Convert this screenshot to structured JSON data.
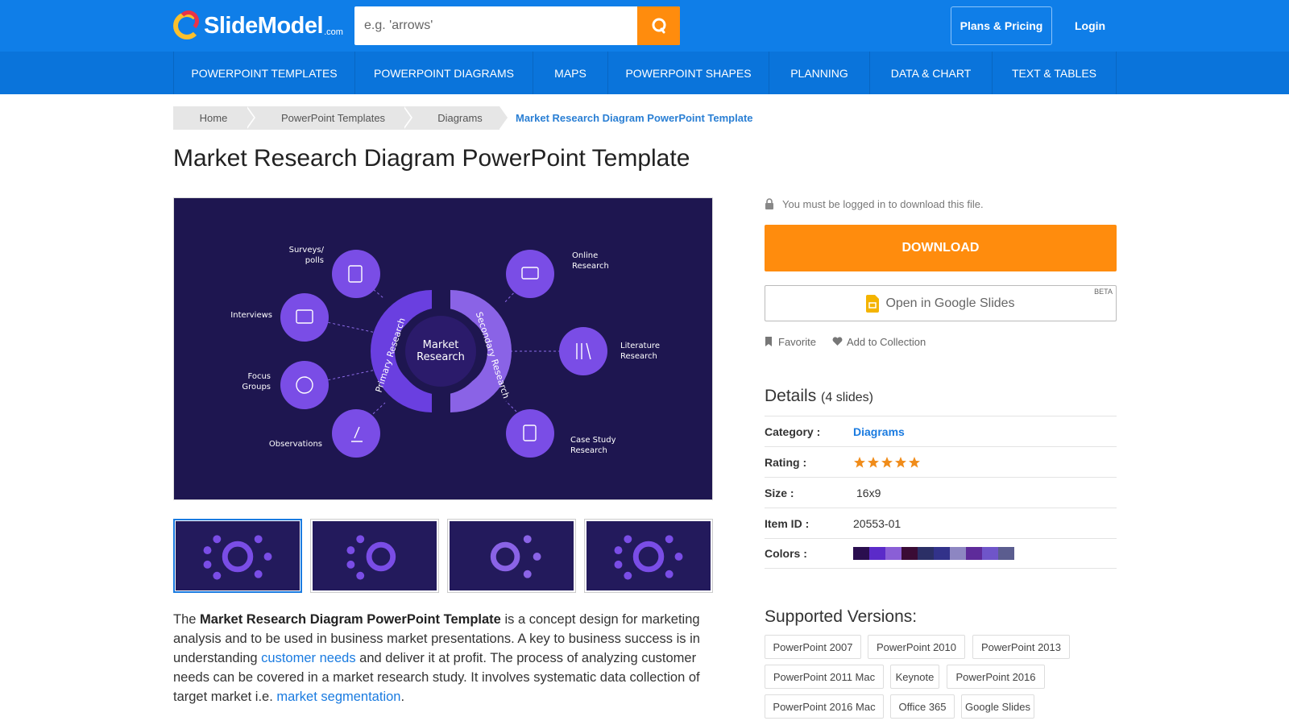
{
  "header": {
    "logo_text": "SlideModel",
    "logo_domain": ".com",
    "search_placeholder": "e.g. 'arrows'",
    "plans_label": "Plans & Pricing",
    "login_label": "Login"
  },
  "nav": {
    "items": [
      {
        "label": "POWERPOINT TEMPLATES"
      },
      {
        "label": "POWERPOINT DIAGRAMS"
      },
      {
        "label": "MAPS"
      },
      {
        "label": "POWERPOINT SHAPES"
      },
      {
        "label": "PLANNING"
      },
      {
        "label": "DATA & CHART"
      },
      {
        "label": "TEXT & TABLES"
      }
    ]
  },
  "breadcrumb": {
    "items": [
      "Home",
      "PowerPoint Templates",
      "Diagrams"
    ],
    "current": "Market Research Diagram PowerPoint Template"
  },
  "page": {
    "title": "Market Research Diagram PowerPoint Template"
  },
  "preview": {
    "center_line1": "Market",
    "center_line2": "Research",
    "ring_left": "Primary Research",
    "ring_right": "Secondary Research",
    "left_labels": [
      {
        "line1": "Surveys/",
        "line2": "polls"
      },
      {
        "line1": "Interviews",
        "line2": ""
      },
      {
        "line1": "Focus",
        "line2": "Groups"
      },
      {
        "line1": "Observations",
        "line2": ""
      }
    ],
    "right_labels": [
      {
        "line1": "Online",
        "line2": "Research"
      },
      {
        "line1": "Literature",
        "line2": "Research"
      },
      {
        "line1": "Case Study",
        "line2": "Research"
      }
    ]
  },
  "description": {
    "p1_a": "The ",
    "p1_bold": "Market Research Diagram PowerPoint Template",
    "p1_b": " is a concept design for marketing analysis and to be used in business market presentations. A key to business success is in understanding ",
    "p1_link1": "customer needs",
    "p1_c": " and deliver it at profit. The process of analyzing customer needs can be covered in a market research study. It involves systematic data collection of target market i.e. ",
    "p1_link2": "market segmentation",
    "p1_d": "."
  },
  "sidebar": {
    "login_note": "You must be logged in to download this file.",
    "download_label": "DOWNLOAD",
    "gslides_label": "Open in Google Slides",
    "beta_label": "BETA",
    "favorite_label": "Favorite",
    "collection_label": "Add to Collection"
  },
  "details": {
    "heading": "Details",
    "slides_count": "(4 slides)",
    "rows": [
      {
        "label": "Category :",
        "value": "Diagrams"
      },
      {
        "label": "Rating :",
        "value": ""
      },
      {
        "label": "Size :",
        "value": "16x9"
      },
      {
        "label": "Item ID :",
        "value": "20553-01"
      },
      {
        "label": "Colors :",
        "value": ""
      }
    ],
    "rating": 5,
    "colors": [
      "#2a0e4f",
      "#5b2bc9",
      "#8a5fd6",
      "#3a0c35",
      "#2b2f66",
      "#32328a",
      "#8d86c2",
      "#5e2b9a",
      "#6f55c9",
      "#5b5d8f"
    ]
  },
  "versions": {
    "heading": "Supported Versions:",
    "items": [
      "PowerPoint 2007",
      "PowerPoint 2010",
      "PowerPoint 2013",
      "PowerPoint 2011 Mac",
      "Keynote",
      "PowerPoint 2016",
      "PowerPoint 2016 Mac",
      "Office 365",
      "Google Slides"
    ]
  },
  "colors": {
    "brand_blue": "#0f7ee8",
    "accent_orange": "#ff8c0d",
    "link_blue": "#1a7be0"
  }
}
